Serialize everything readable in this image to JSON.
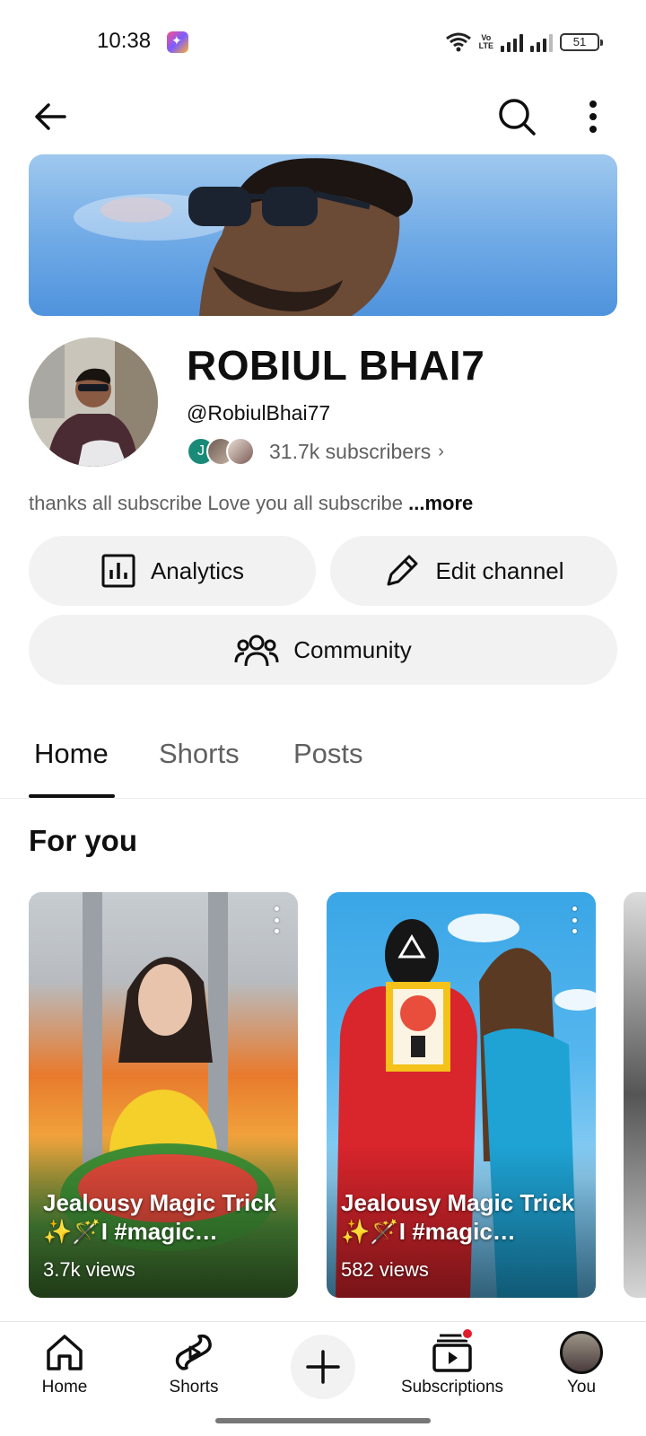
{
  "status_bar": {
    "time": "10:38",
    "volte_label": "VoD LTE2",
    "battery": "51"
  },
  "top_bar": {
    "back_icon": "arrow-left-icon",
    "search_icon": "search-icon",
    "more_icon": "more-vertical-icon"
  },
  "channel": {
    "name": "ROBIUL BHAI7",
    "handle": "@RobiulBhai77",
    "subscriber_avatar_initial": "J",
    "subscribers": "31.7k subscribers",
    "description": "thanks all subscribe Love you all subscribe ",
    "more_label": "...more"
  },
  "actions": {
    "analytics": "Analytics",
    "edit_channel": "Edit channel",
    "community": "Community"
  },
  "tabs": [
    {
      "label": "Home",
      "active": true
    },
    {
      "label": "Shorts",
      "active": false
    },
    {
      "label": "Posts",
      "active": false
    }
  ],
  "section": {
    "title": "For you"
  },
  "shorts": [
    {
      "title": "Jealousy Magic Trick ✨🪄I #magic…",
      "views": "3.7k views"
    },
    {
      "title": "Jealousy Magic Trick ✨🪄I #magic…",
      "views": "582 views"
    }
  ],
  "bottom_nav": {
    "home": "Home",
    "shorts": "Shorts",
    "subscriptions": "Subscriptions",
    "you": "You"
  }
}
